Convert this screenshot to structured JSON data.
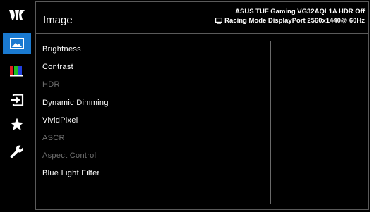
{
  "header": {
    "title": "Image",
    "model_line": "ASUS TUF Gaming  VG32AQL1A HDR Off",
    "status_line": "Racing Mode  DisplayPort  2560x1440@ 60Hz"
  },
  "menu": {
    "items": [
      {
        "label": "Brightness",
        "enabled": true
      },
      {
        "label": "Contrast",
        "enabled": true
      },
      {
        "label": "HDR",
        "enabled": false
      },
      {
        "label": "Dynamic Dimming",
        "enabled": true
      },
      {
        "label": "VividPixel",
        "enabled": true
      },
      {
        "label": "ASCR",
        "enabled": false
      },
      {
        "label": "Aspect Control",
        "enabled": false
      },
      {
        "label": "Blue Light Filter",
        "enabled": true
      }
    ]
  },
  "sidebar": {
    "items": [
      {
        "icon": "image-icon",
        "active": true
      },
      {
        "icon": "color-icon",
        "active": false
      },
      {
        "icon": "input-select-icon",
        "active": false
      },
      {
        "icon": "star-icon",
        "active": false
      },
      {
        "icon": "wrench-icon",
        "active": false
      }
    ]
  },
  "colors": {
    "accent": "#1a7ad1",
    "background": "#000000",
    "disabled_text": "#707070"
  }
}
